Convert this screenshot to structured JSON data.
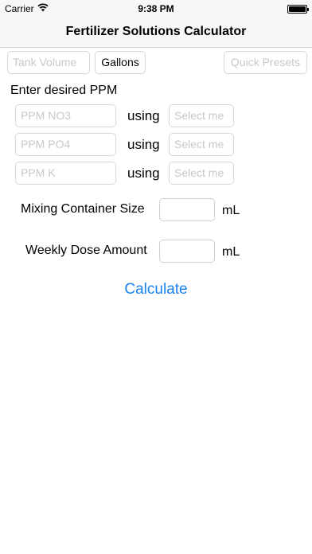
{
  "status_bar": {
    "carrier": "Carrier",
    "time": "9:38 PM"
  },
  "nav": {
    "title": "Fertilizer Solutions Calculator"
  },
  "toolbar": {
    "tank_volume_placeholder": "Tank Volume",
    "units_label": "Gallons",
    "presets_label": "Quick Presets"
  },
  "ppm": {
    "heading": "Enter desired PPM",
    "using_label": "using",
    "rows": [
      {
        "placeholder": "PPM NO3",
        "select": "Select me"
      },
      {
        "placeholder": "PPM PO4",
        "select": "Select me"
      },
      {
        "placeholder": "PPM K",
        "select": "Select me"
      }
    ]
  },
  "mixing": {
    "label": "Mixing Container Size",
    "unit": "mL",
    "value": ""
  },
  "weekly": {
    "label": "Weekly Dose Amount",
    "unit": "mL",
    "value": ""
  },
  "calculate_label": "Calculate",
  "colors": {
    "accent": "#1a82f0",
    "border": "#d8d8d8",
    "placeholder": "#c7c7cd"
  }
}
